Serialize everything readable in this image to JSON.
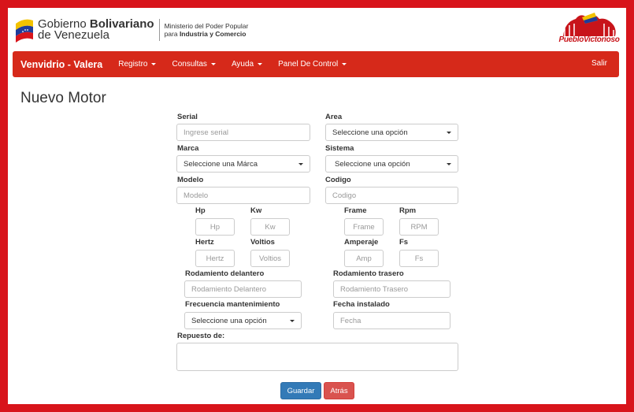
{
  "header": {
    "gov_name_line1_regular": "Gobierno ",
    "gov_name_line1_bold": "Bolivariano",
    "gov_name_line2": "de Venezuela",
    "ministry_line1": "Ministerio del Poder Popular",
    "ministry_line2_regular": "para ",
    "ministry_line2_bold": "Industria y Comercio",
    "logo_text": "PuebloVictorioso"
  },
  "navbar": {
    "brand": "Venvidrio - Valera",
    "items": [
      "Registro",
      "Consultas",
      "Ayuda",
      "Panel De Control"
    ],
    "logout": "Salir"
  },
  "page": {
    "title": "Nuevo Motor"
  },
  "form": {
    "serial": {
      "label": "Serial",
      "placeholder": "Ingrese serial"
    },
    "area": {
      "label": "Area",
      "value": "Seleccione una opción"
    },
    "marca": {
      "label": "Marca",
      "value": "Seleccione una Márca"
    },
    "sistema": {
      "label": "Sistema",
      "value": "Seleccione una opción"
    },
    "modelo": {
      "label": "Modelo",
      "placeholder": "Modelo"
    },
    "codigo": {
      "label": "Codigo",
      "placeholder": "Codigo"
    },
    "hp": {
      "label": "Hp",
      "placeholder": "Hp"
    },
    "kw": {
      "label": "Kw",
      "placeholder": "Kw"
    },
    "frame": {
      "label": "Frame",
      "placeholder": "Frame"
    },
    "rpm": {
      "label": "Rpm",
      "placeholder": "RPM"
    },
    "hertz": {
      "label": "Hertz",
      "placeholder": "Hertz"
    },
    "voltios": {
      "label": "Voltios",
      "placeholder": "Voltios"
    },
    "amperaje": {
      "label": "Amperaje",
      "placeholder": "Amp"
    },
    "fs": {
      "label": "Fs",
      "placeholder": "Fs"
    },
    "rod_del": {
      "label": "Rodamiento delantero",
      "placeholder": "Rodamiento Delantero"
    },
    "rod_tra": {
      "label": "Rodamiento trasero",
      "placeholder": "Rodamiento Trasero"
    },
    "frecuencia": {
      "label": "Frecuencia mantenimiento",
      "value": "Seleccione una opción"
    },
    "fecha": {
      "label": "Fecha instalado",
      "placeholder": "Fecha"
    },
    "repuesto": {
      "label": "Repuesto de:"
    }
  },
  "buttons": {
    "save": "Guardar",
    "back": "Atrás"
  },
  "colors": {
    "frame": "#d8141b",
    "navbar": "#d6291a",
    "primary": "#337ab7",
    "danger": "#d9534f"
  }
}
